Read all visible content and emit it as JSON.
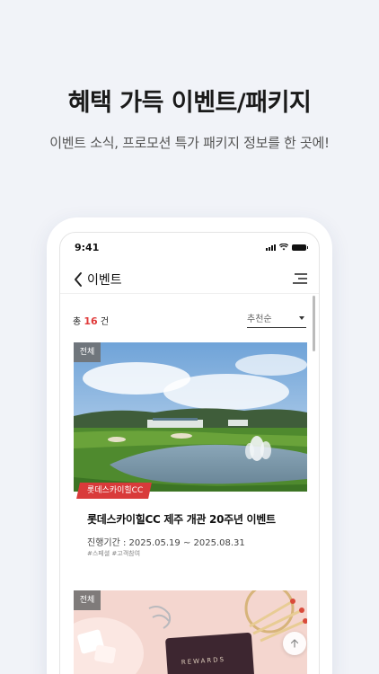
{
  "promo": {
    "title": "혜택 가득 이벤트/패키지",
    "subtitle": "이벤트 소식, 프로모션 특가 패키지 정보를 한 곳에!"
  },
  "statusbar": {
    "time": "9:41"
  },
  "header": {
    "title": "이벤트",
    "back_icon": "chevron-left-icon",
    "menu_icon": "menu-icon"
  },
  "list": {
    "count_prefix": "총",
    "count_value": "16",
    "count_suffix": "건",
    "sort_selected": "추천순"
  },
  "events": [
    {
      "badge": "전체",
      "tag": "롯데스카이힐CC",
      "title": "롯데스카이힐CC 제주 개관 20주년 이벤트",
      "period": "진행기간 : 2025.05.19 ~ 2025.08.31",
      "hashtags": "#스페셜 #고객참여"
    },
    {
      "badge": "전체"
    }
  ],
  "colors": {
    "accent": "#e03a3a",
    "ribbon": "#d93a3a",
    "background": "#f1f3f8"
  }
}
